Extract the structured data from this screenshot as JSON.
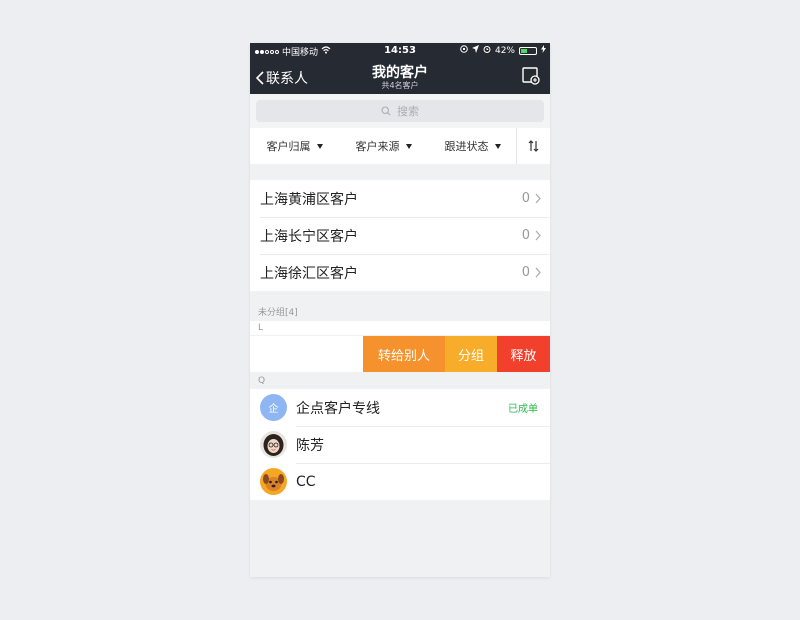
{
  "status_bar": {
    "carrier": "中国移动",
    "time": "14:53",
    "battery": "42%"
  },
  "nav": {
    "back_label": "联系人",
    "title": "我的客户",
    "subtitle": "共4名客户"
  },
  "search": {
    "placeholder": "搜索"
  },
  "filters": [
    {
      "label": "客户归属"
    },
    {
      "label": "客户来源"
    },
    {
      "label": "跟进状态"
    }
  ],
  "groups": [
    {
      "name": "上海黄浦区客户",
      "count": "0"
    },
    {
      "name": "上海长宁区客户",
      "count": "0"
    },
    {
      "name": "上海徐汇区客户",
      "count": "0"
    }
  ],
  "ungrouped_label": "未分组[4]",
  "letters": {
    "l": "L",
    "q": "Q"
  },
  "swipe_actions": {
    "transfer": "转给别人",
    "group": "分组",
    "release": "释放"
  },
  "contacts": [
    {
      "name": "企点客户专线",
      "avatar_text": "企",
      "tag": "已成单"
    },
    {
      "name": "陈芳",
      "tag": ""
    },
    {
      "name": "CC",
      "tag": ""
    }
  ],
  "colors": {
    "nav_bg": "#262a33",
    "transfer": "#f6922e",
    "group": "#f8ad2a",
    "release": "#f1402b",
    "deal_green": "#2bb94e"
  }
}
